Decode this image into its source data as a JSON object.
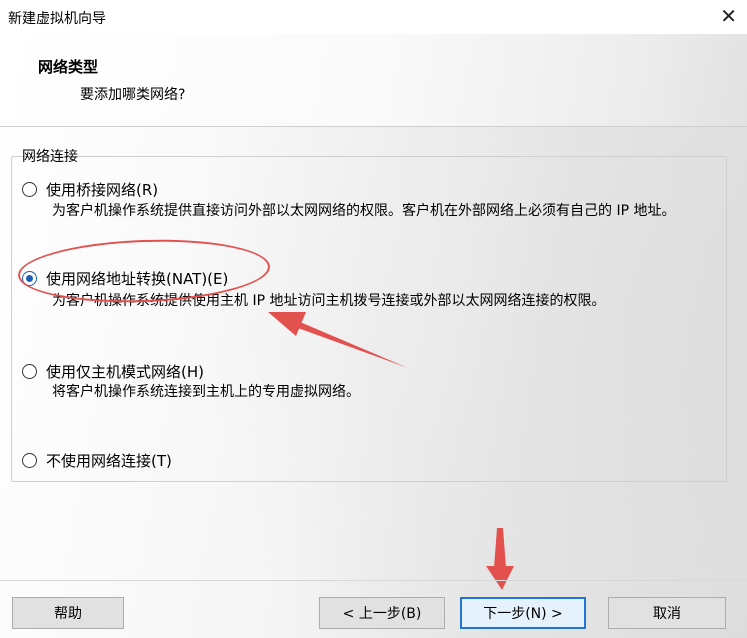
{
  "window": {
    "title": "新建虚拟机向导",
    "close_glyph": "✕"
  },
  "header": {
    "heading": "网络类型",
    "subheading": "要添加哪类网络?"
  },
  "group": {
    "legend": "网络连接"
  },
  "options": [
    {
      "label": "使用桥接网络(R)",
      "description": "为客户机操作系统提供直接访问外部以太网网络的权限。客户机在外部网络上必须有自己的 IP 地址。",
      "selected": false
    },
    {
      "label": "使用网络地址转换(NAT)(E)",
      "description": "为客户机操作系统提供使用主机 IP 地址访问主机拨号连接或外部以太网网络连接的权限。",
      "selected": true
    },
    {
      "label": "使用仅主机模式网络(H)",
      "description": "将客户机操作系统连接到主机上的专用虚拟网络。",
      "selected": false
    },
    {
      "label": "不使用网络连接(T)",
      "description": "",
      "selected": false
    }
  ],
  "buttons": {
    "help": "帮助",
    "back": "< 上一步(B)",
    "next": "下一步(N) >",
    "cancel": "取消"
  },
  "colors": {
    "annotation_red": "#e3514f",
    "radio_selected": "#1a5fb4",
    "default_button_border": "#1f74d6"
  }
}
